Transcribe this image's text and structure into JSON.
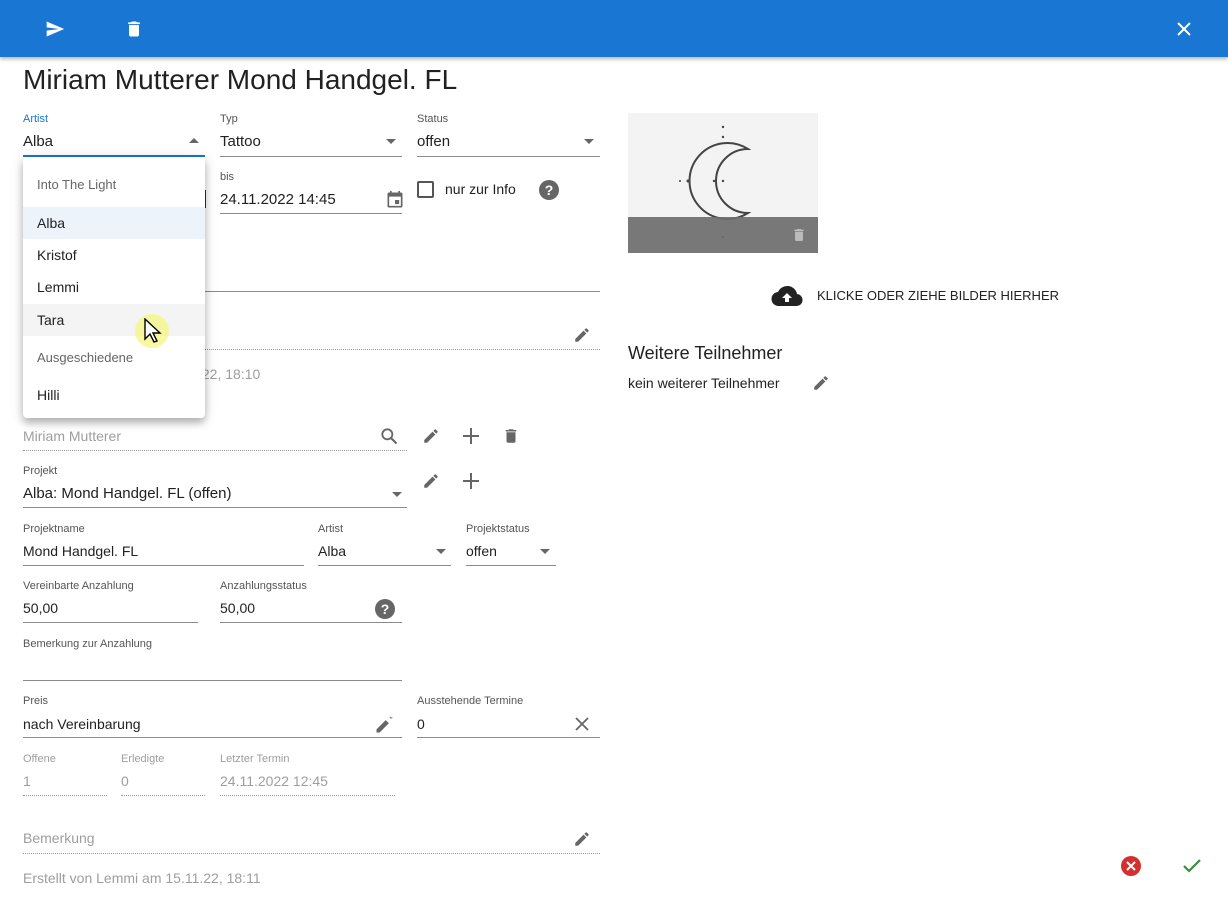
{
  "header": {
    "send_icon": "send-icon",
    "delete_icon": "delete-icon",
    "close_icon": "close-icon",
    "color": "#1976d2"
  },
  "title": "Miriam Mutterer Mond Handgel. FL",
  "artist": {
    "label": "Artist",
    "value": "Alba"
  },
  "typ": {
    "label": "Typ",
    "value": "Tattoo"
  },
  "status": {
    "label": "Status",
    "value": "offen"
  },
  "bis": {
    "label": "bis",
    "value": "24.11.2022 14:45"
  },
  "nur_info": {
    "label": "nur zur Info",
    "checked": false
  },
  "artist_menu": {
    "items": [
      {
        "label": "Into The Light",
        "type": "header"
      },
      {
        "label": "Alba",
        "selected": true
      },
      {
        "label": "Kristof"
      },
      {
        "label": "Lemmi"
      },
      {
        "label": "Tara",
        "hovered": true
      },
      {
        "label": "Ausgeschiedene",
        "type": "header"
      },
      {
        "label": "Hilli"
      }
    ]
  },
  "edited_partial": ".22, 18:10",
  "customer": {
    "placeholder": "Miriam Mutterer"
  },
  "projekt": {
    "label": "Projekt",
    "value": "Alba: Mond Handgel. FL (offen)"
  },
  "projektname": {
    "label": "Projektname",
    "value": "Mond Handgel. FL"
  },
  "projekt_artist": {
    "label": "Artist",
    "value": "Alba"
  },
  "projektstatus": {
    "label": "Projektstatus",
    "value": "offen"
  },
  "anzahlung": {
    "label": "Vereinbarte Anzahlung",
    "value": "50,00"
  },
  "anzahlungsstatus": {
    "label": "Anzahlungsstatus",
    "value": "50,00"
  },
  "bemerkung_anzahlung": {
    "label": "Bemerkung zur Anzahlung",
    "value": ""
  },
  "preis": {
    "label": "Preis",
    "value": "nach Vereinbarung"
  },
  "ausstehende": {
    "label": "Ausstehende Termine",
    "value": "0"
  },
  "offene": {
    "label": "Offene",
    "value": "1"
  },
  "erledigte": {
    "label": "Erledigte",
    "value": "0"
  },
  "letzter": {
    "label": "Letzter Termin",
    "value": "24.11.2022 12:45"
  },
  "bemerkung": {
    "placeholder": "Bemerkung"
  },
  "created": "Erstellt von Lemmi am 15.11.22, 18:11",
  "upload": {
    "label": "KLICKE ODER ZIEHE BILDER HIERHER"
  },
  "teilnehmer": {
    "title": "Weitere Teilnehmer",
    "value": "kein weiterer Teilnehmer"
  },
  "colors": {
    "cancel": "#d32f2f",
    "confirm": "#388e3c"
  }
}
